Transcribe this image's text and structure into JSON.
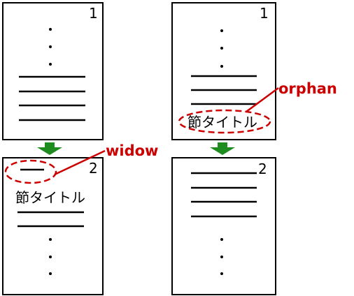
{
  "diagram": {
    "left": {
      "page_top": {
        "number": "1"
      },
      "page_bottom": {
        "number": "2",
        "heading": "節タイトル"
      },
      "callout_label": "widow"
    },
    "right": {
      "page_top": {
        "number": "1",
        "heading": "節タイトル"
      },
      "page_bottom": {
        "number": "2"
      },
      "callout_label": "orphan"
    }
  },
  "colors": {
    "accent_red": "#cc0000",
    "arrow_green": "#1f8c1f",
    "ink": "#000000"
  }
}
